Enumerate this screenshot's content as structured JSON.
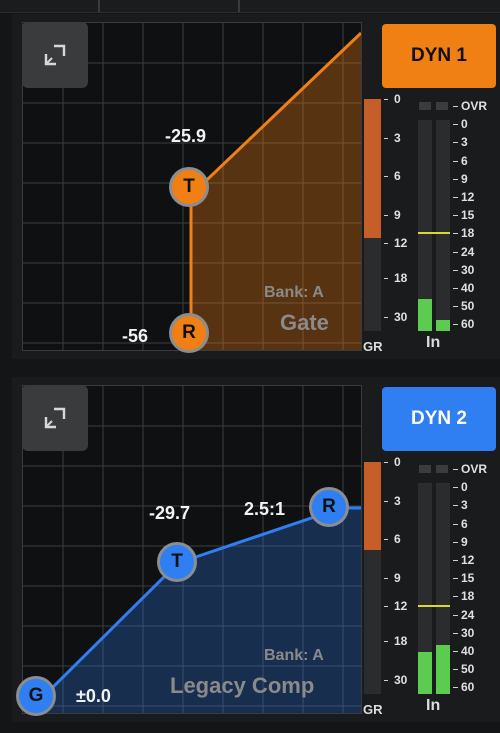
{
  "panels": [
    {
      "name": "DYN 1",
      "accent": "#f07f14",
      "threshold_label": "-25.9",
      "range_label": "-56",
      "handle_t": "T",
      "handle_r": "R",
      "bank": "Bank: A",
      "mode": "Gate",
      "gr_scale": [
        "0",
        "3",
        "6",
        "9",
        "12",
        "18",
        "30"
      ],
      "in_scale": [
        "OVR",
        "0",
        "3",
        "6",
        "9",
        "12",
        "15",
        "18",
        "24",
        "30",
        "40",
        "50",
        "60"
      ],
      "gr_caption": "GR",
      "in_caption": "In",
      "gr_level": 0.6,
      "in_levels": [
        0.15,
        0.05
      ]
    },
    {
      "name": "DYN 2",
      "accent": "#2f7ef2",
      "threshold_label": "-29.7",
      "ratio_label": "2.5:1",
      "gain_label": "±0.0",
      "handle_g": "G",
      "handle_t": "T",
      "handle_r": "R",
      "bank": "Bank: A",
      "mode": "Legacy Comp",
      "gr_scale": [
        "0",
        "3",
        "6",
        "9",
        "12",
        "18",
        "30"
      ],
      "in_scale": [
        "OVR",
        "0",
        "3",
        "6",
        "9",
        "12",
        "15",
        "18",
        "24",
        "30",
        "40",
        "50",
        "60"
      ],
      "gr_caption": "GR",
      "in_caption": "In",
      "gr_level": 0.38,
      "in_levels": [
        0.2,
        0.23
      ]
    }
  ],
  "icons": {
    "expand": "expand-icon"
  }
}
